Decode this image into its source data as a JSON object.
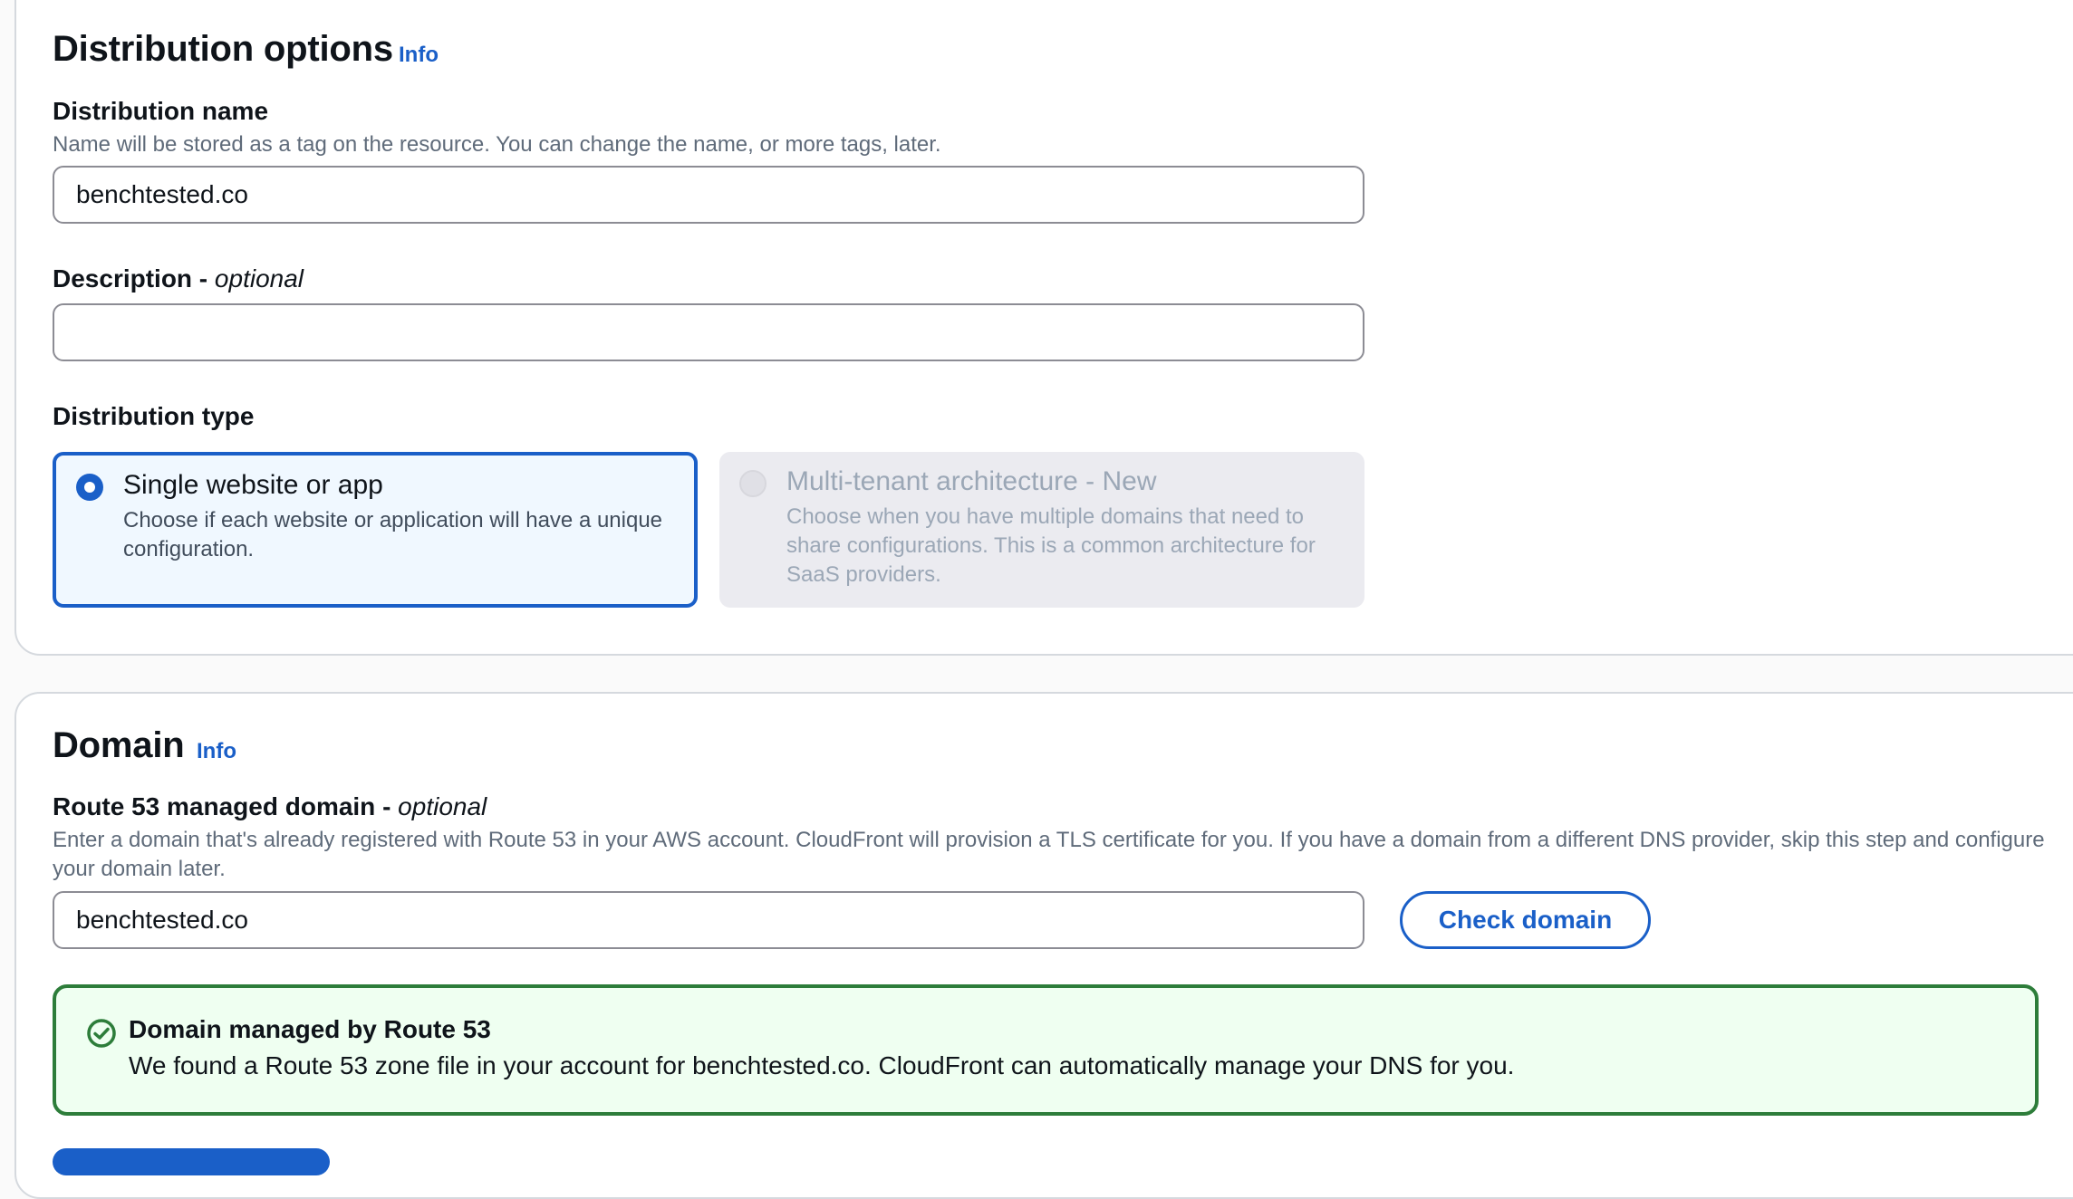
{
  "distribution_options": {
    "heading": "Distribution options",
    "info_link": "Info",
    "name_label": "Distribution name",
    "name_description": "Name will be stored as a tag on the resource. You can change the name, or more tags, later.",
    "name_value": "benchtested.co",
    "description_label": "Description - ",
    "description_optional": "optional",
    "description_value": "",
    "type_label": "Distribution type",
    "type_options": [
      {
        "title": "Single website or app",
        "description": "Choose if each website or application will have a unique configuration.",
        "selected": true,
        "disabled": false
      },
      {
        "title": "Multi-tenant architecture - New",
        "description": "Choose when you have multiple domains that need to share configurations. This is a common architecture for SaaS providers.",
        "selected": false,
        "disabled": true
      }
    ]
  },
  "domain": {
    "heading": "Domain",
    "info_link": "Info",
    "route53_label": "Route 53 managed domain - ",
    "route53_optional": "optional",
    "route53_description": "Enter a domain that's already registered with Route 53 in your AWS account. CloudFront will provision a TLS certificate for you. If you have a domain from a different DNS provider, skip this step and configure your domain later.",
    "domain_value": "benchtested.co",
    "check_button": "Check domain",
    "alert": {
      "title": "Domain managed by Route 53",
      "message": "We found a Route 53 zone file in your account for benchtested.co. CloudFront can automatically manage your DNS for you.",
      "icon": "check-circle-icon"
    }
  },
  "colors": {
    "accent": "#1a5fc8",
    "success": "#2d7d3a",
    "success_bg": "#effff1"
  }
}
